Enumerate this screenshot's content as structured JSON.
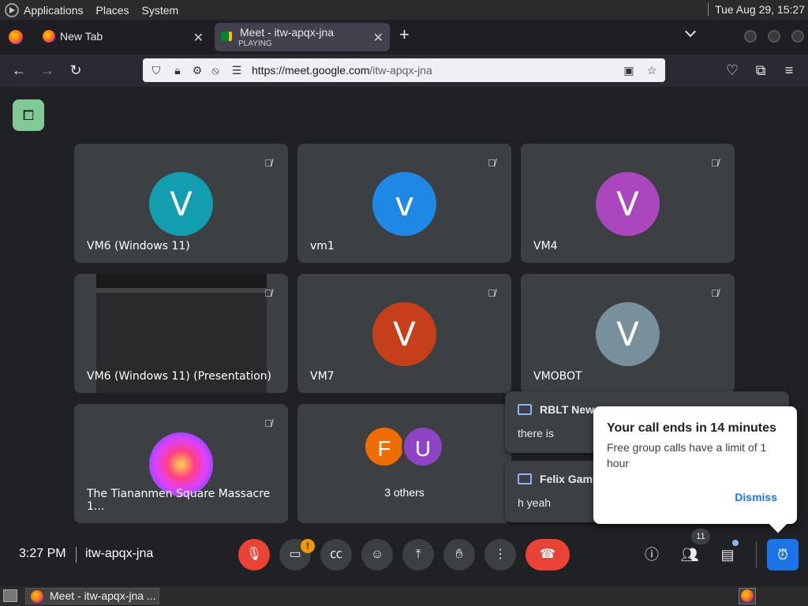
{
  "system_bar": {
    "menus": [
      "Applications",
      "Places",
      "System"
    ],
    "clock": "Tue Aug 29, 15:27"
  },
  "browser": {
    "tabs": [
      {
        "title": "New Tab"
      },
      {
        "title": "Meet - itw-apqx-jna",
        "status": "PLAYING"
      }
    ],
    "url_host": "https://meet.google.com",
    "url_path": "/itw-apqx-jna"
  },
  "meet": {
    "tiles": [
      {
        "name": "VM6 (Windows 11)",
        "initial": "V",
        "color": "#129eaf"
      },
      {
        "name": "vm1",
        "initial": "v",
        "color": "#1e88e5"
      },
      {
        "name": "VM4",
        "initial": "V",
        "color": "#ab47bc"
      },
      {
        "name": "VM6 (Windows 11) (Presentation)"
      },
      {
        "name": "VM7",
        "initial": "V",
        "color": "#c5401a"
      },
      {
        "name": "VMOBOT",
        "initial": "V",
        "color": "#78909c"
      },
      {
        "name": "The Tiananmen Square Massacre 1..."
      },
      {
        "name": "3 others",
        "initials": [
          "F",
          "U"
        ],
        "colors": [
          "#ef6c00",
          "#8e44c4"
        ]
      }
    ],
    "chat_toasts": [
      {
        "sender": "RBLT New",
        "message": "there is"
      },
      {
        "sender": "Felix Gami",
        "message": "h yeah"
      }
    ],
    "popup": {
      "title": "Your call ends in 14 minutes",
      "body": "Free group calls have a limit of 1 hour",
      "dismiss": "Dismiss"
    },
    "bottom_bar": {
      "time": "3:27 PM",
      "meeting_code": "itw-apqx-jna",
      "camera_badge": "!",
      "participant_count": "11"
    }
  },
  "taskbar": {
    "task_label": "Meet - itw-apqx-jna ..."
  },
  "icons": {
    "mic_off": "mic-off-icon",
    "camera": "camera-icon",
    "captions": "captions-icon",
    "emoji": "emoji-icon",
    "present": "present-icon",
    "hand": "raise-hand-icon",
    "more": "more-icon",
    "end_call": "end-call-icon",
    "info": "info-icon",
    "people": "people-icon",
    "chat": "chat-icon",
    "alarm": "alarm-icon"
  }
}
